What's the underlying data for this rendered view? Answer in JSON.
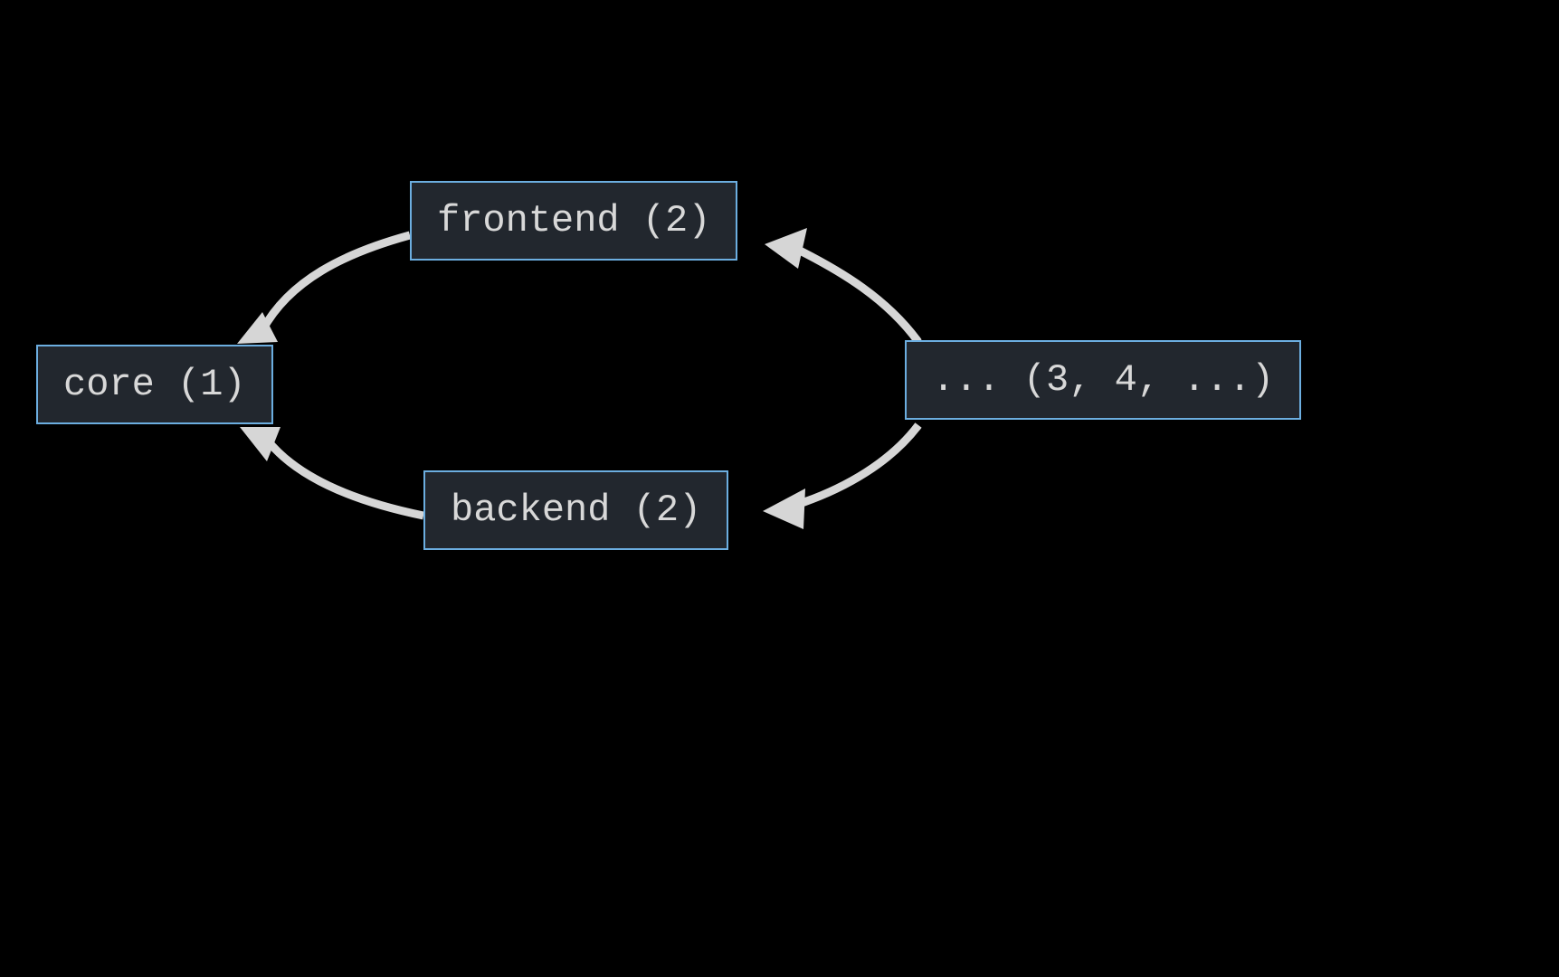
{
  "diagram": {
    "nodes": {
      "core": {
        "label": "core (1)"
      },
      "frontend": {
        "label": "frontend (2)"
      },
      "backend": {
        "label": "backend (2)"
      },
      "more": {
        "label": "... (3, 4, ...)"
      }
    },
    "edges": [
      {
        "from": "frontend",
        "to": "core"
      },
      {
        "from": "backend",
        "to": "core"
      },
      {
        "from": "more",
        "to": "frontend"
      },
      {
        "from": "more",
        "to": "backend"
      }
    ],
    "colors": {
      "background": "#000000",
      "node_fill": "#22272e",
      "node_border": "#6caee0",
      "node_text": "#d8d8d8",
      "edge": "#d6d6d6"
    }
  }
}
